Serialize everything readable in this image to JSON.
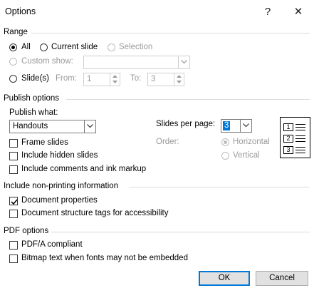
{
  "window": {
    "title": "Options",
    "help_glyph": "?",
    "close_glyph": "✕"
  },
  "range": {
    "section_label": "Range",
    "all_label": "All",
    "current_slide_label": "Current slide",
    "selection_label": "Selection",
    "custom_show_label": "Custom show:",
    "custom_show_value": "",
    "slides_label": "Slide(s)",
    "from_label": "From:",
    "from_value": "1",
    "to_label": "To:",
    "to_value": "3",
    "selected": "all"
  },
  "publish": {
    "section_label": "Publish options",
    "publish_what_label": "Publish what:",
    "publish_what_value": "Handouts",
    "slides_per_page_label": "Slides per page:",
    "slides_per_page_value": "3",
    "order_label": "Order:",
    "horizontal_label": "Horizontal",
    "vertical_label": "Vertical",
    "order_selected": "horizontal",
    "frame_slides_label": "Frame slides",
    "frame_slides_checked": false,
    "include_hidden_label": "Include hidden slides",
    "include_hidden_checked": false,
    "include_comments_label": "Include comments and ink markup",
    "include_comments_checked": false,
    "preview_numbers": [
      "1",
      "2",
      "3"
    ]
  },
  "non_printing": {
    "section_label": "Include non-printing information",
    "doc_properties_label": "Document properties",
    "doc_properties_checked": true,
    "structure_tags_label": "Document structure tags for accessibility",
    "structure_tags_checked": false
  },
  "pdf": {
    "section_label": "PDF options",
    "pdfa_label": "PDF/A compliant",
    "pdfa_checked": false,
    "bitmap_label": "Bitmap text when fonts may not be embedded",
    "bitmap_checked": false
  },
  "buttons": {
    "ok_label": "OK",
    "cancel_label": "Cancel"
  },
  "colors": {
    "accent": "#0078d7",
    "button_bg": "#e1e1e1",
    "separator": "#dcdcdc",
    "disabled_text": "#9a9a9a"
  }
}
